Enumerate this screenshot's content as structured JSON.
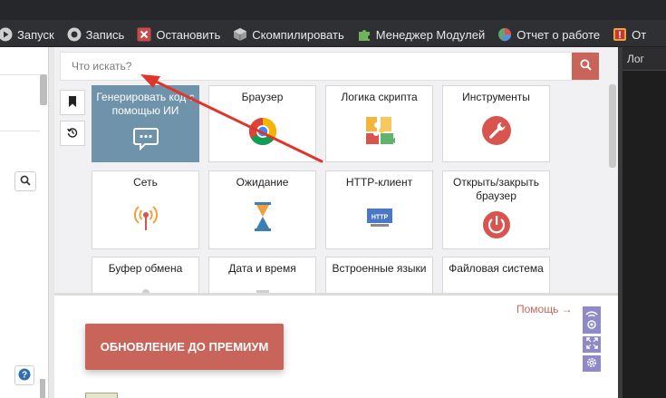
{
  "toolbar": {
    "items": [
      {
        "label": "Запуск",
        "icon": "play-icon"
      },
      {
        "label": "Запись",
        "icon": "record-icon"
      },
      {
        "label": "Остановить",
        "icon": "stop-icon"
      },
      {
        "label": "Скомпилировать",
        "icon": "cube-icon"
      },
      {
        "label": "Менеджер Модулей",
        "icon": "puzzle-icon"
      },
      {
        "label": "Отчет о работе",
        "icon": "pie-chart-icon"
      },
      {
        "label": "От",
        "icon": "alert-icon"
      }
    ]
  },
  "search": {
    "placeholder": "Что искать?",
    "button_icon": "search-icon"
  },
  "side_buttons": [
    "bookmark-icon",
    "history-icon"
  ],
  "tiles": [
    {
      "label": "Генерировать код с помощью ИИ",
      "icon": "chat-bubble-icon"
    },
    {
      "label": "Браузер",
      "icon": "chrome-icon"
    },
    {
      "label": "Логика скрипта",
      "icon": "puzzle-pieces-icon"
    },
    {
      "label": "Инструменты",
      "icon": "wrench-icon"
    },
    {
      "label": "Сеть",
      "icon": "antenna-icon"
    },
    {
      "label": "Ожидание",
      "icon": "hourglass-icon"
    },
    {
      "label": "HTTP-клиент",
      "icon": "http-icon"
    },
    {
      "label": "Открыть/закрыть браузер",
      "icon": "power-icon"
    },
    {
      "label": "Буфер обмена",
      "icon": "clipboard-icon"
    },
    {
      "label": "Дата и время",
      "icon": "calendar-icon"
    },
    {
      "label": "Встроенные языки",
      "icon": "code-icon"
    },
    {
      "label": "Файловая система",
      "icon": "folder-icon"
    }
  ],
  "http_icon_text": "HTTP",
  "lower": {
    "help_link": "Помощь →",
    "premium_button": "ОБНОВЛЕНИЕ ДО ПРЕМИУМ",
    "right_tools": [
      "wifi-icon",
      "fullscreen-icon",
      "settings-icon"
    ]
  },
  "log_panel": {
    "title": "Лог"
  },
  "colors": {
    "accent": "#c9645a",
    "ai_tile": "#6e93aa",
    "tool_purple": "#8e8ac9",
    "toolbar_bg": "#2f3033",
    "annotation_arrow": "#e0352b"
  }
}
